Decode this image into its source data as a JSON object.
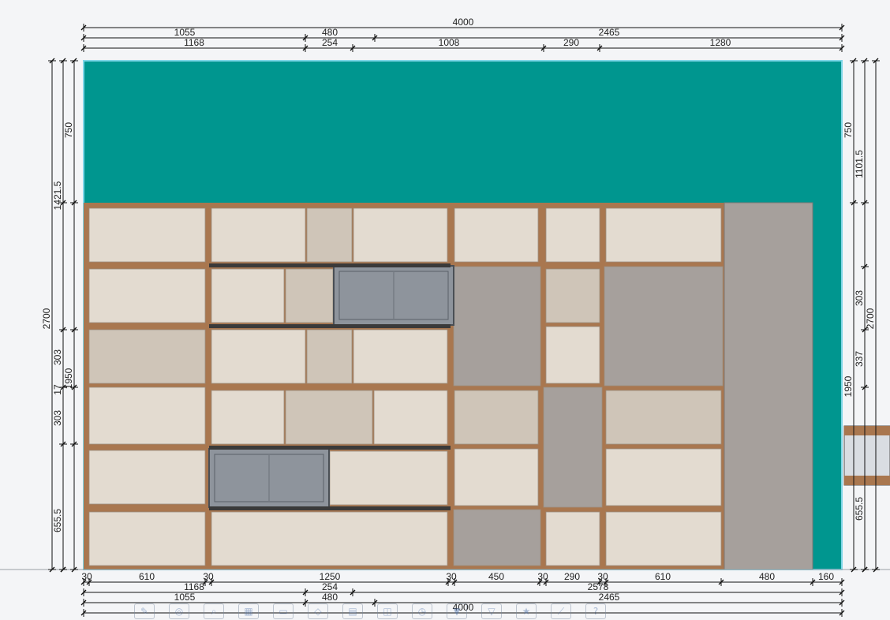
{
  "colors": {
    "background": "#f4f5f7",
    "wall": "#00968f",
    "frame": "#a9774f",
    "panel_light": "#e3dbd0",
    "panel_textured": "#cfc5b8",
    "panel_gray": "#a6a09c",
    "insert_gray": "#8e949c",
    "shelf_dark": "#3a3a3a"
  },
  "dimensions": {
    "top": {
      "total": "4000",
      "row2": [
        "1055",
        "480",
        "2465"
      ],
      "row3": [
        "1168",
        "254",
        "1008",
        "290",
        "1280"
      ]
    },
    "bottom": {
      "row1": [
        "30",
        "610",
        "30",
        "1250",
        "30",
        "450",
        "30",
        "290",
        "30",
        "610",
        "480",
        "160"
      ],
      "row2": [
        "1168",
        "254",
        "2578"
      ],
      "row3": [
        "1055",
        "480",
        "2465"
      ],
      "total": "4000"
    },
    "left": {
      "total": "2700",
      "upper": "1421.5",
      "wall": "750",
      "cabinet": "1950",
      "mid": [
        "303",
        "17",
        "303"
      ],
      "low": "655.5"
    },
    "right": {
      "total": "2700",
      "upper": "1101.5",
      "wall": "750",
      "cabinet": "1950",
      "mid": [
        "303",
        "337"
      ],
      "low": "655.5"
    }
  },
  "toolbar": {
    "icons": [
      "pencil-icon",
      "globe-icon",
      "zoom-icon",
      "grid-icon",
      "door-icon",
      "box-icon",
      "view-front-icon",
      "view-side-icon",
      "clock-icon",
      "filter-icon",
      "filter-alt-icon",
      "star-icon",
      "wand-icon",
      "help-icon"
    ],
    "glyphs": [
      "✎",
      "◎",
      "⌕",
      "▦",
      "▭",
      "◇",
      "▤",
      "◫",
      "◷",
      "▼",
      "▽",
      "★",
      "⟋",
      "?"
    ]
  }
}
